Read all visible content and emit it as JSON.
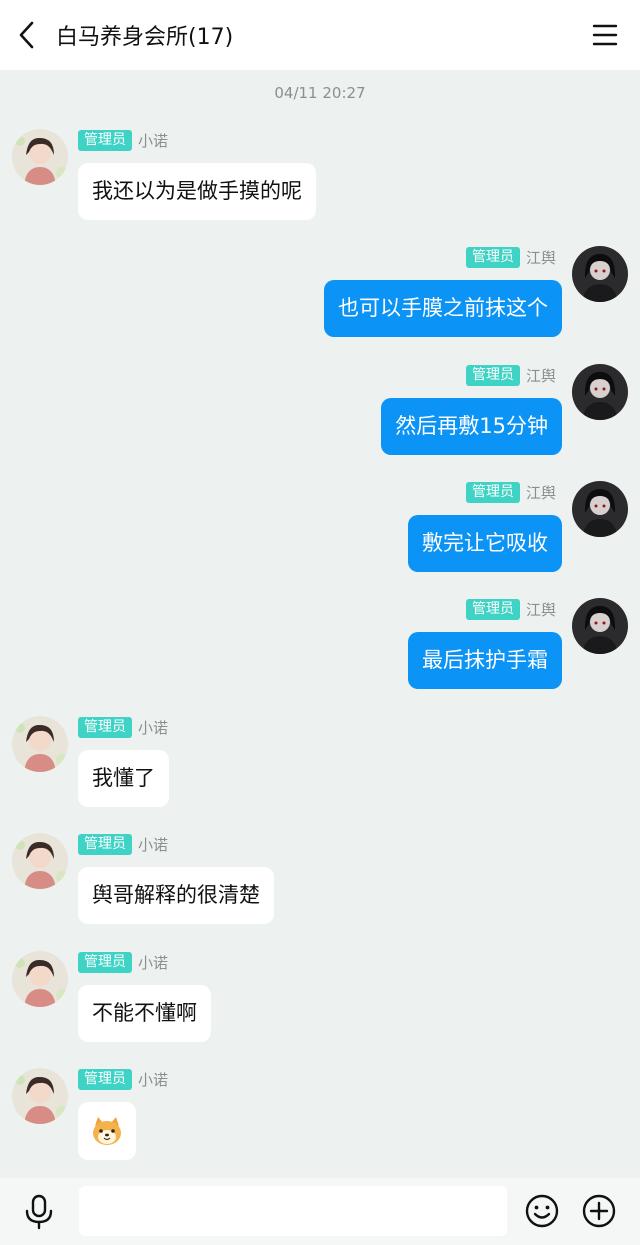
{
  "header": {
    "title": "白马养身会所(17)"
  },
  "chat": {
    "timestamp": "04/11 20:27",
    "messages": [
      {
        "side": "left",
        "badge": "管理员",
        "sender": "小诺",
        "text": "我还以为是做手摸的呢"
      },
      {
        "side": "right",
        "badge": "管理员",
        "sender": "江舆",
        "text": "也可以手膜之前抹这个"
      },
      {
        "side": "right",
        "badge": "管理员",
        "sender": "江舆",
        "text": "然后再敷15分钟"
      },
      {
        "side": "right",
        "badge": "管理员",
        "sender": "江舆",
        "text": "敷完让它吸收"
      },
      {
        "side": "right",
        "badge": "管理员",
        "sender": "江舆",
        "text": "最后抹护手霜"
      },
      {
        "side": "left",
        "badge": "管理员",
        "sender": "小诺",
        "text": "我懂了"
      },
      {
        "side": "left",
        "badge": "管理员",
        "sender": "小诺",
        "text": "舆哥解释的很清楚"
      },
      {
        "side": "left",
        "badge": "管理员",
        "sender": "小诺",
        "text": "不能不懂啊"
      },
      {
        "side": "left",
        "badge": "管理员",
        "sender": "小诺",
        "text": "",
        "sticker": "shiba-dog-sticker"
      }
    ]
  },
  "inputbar": {
    "value": "",
    "icons": [
      "microphone-icon",
      "emoji-icon",
      "plus-icon"
    ]
  },
  "colors": {
    "background": "#edf1ef",
    "badge": "#3fd3c6",
    "bubble_right": "#0b93f5",
    "bubble_left": "#ffffff"
  }
}
